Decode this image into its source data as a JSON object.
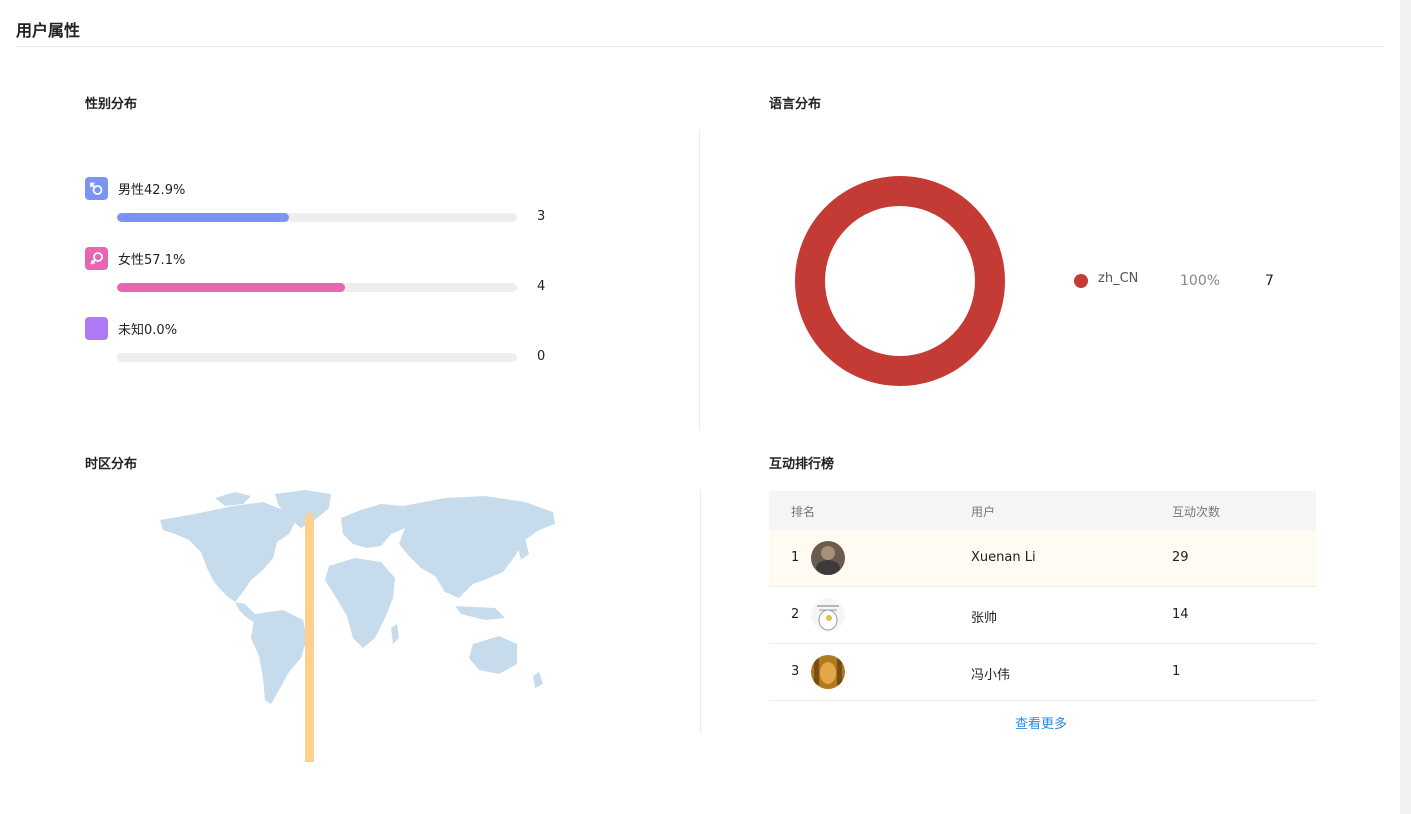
{
  "page": {
    "title": "用户属性"
  },
  "gender": {
    "title": "性别分布",
    "items": [
      {
        "key": "male",
        "label": "男性",
        "percent": "42.9%",
        "fraction": 0.429,
        "count": "3",
        "color": "#7b93f3",
        "icon": "male-icon"
      },
      {
        "key": "female",
        "label": "女性",
        "percent": "57.1%",
        "fraction": 0.571,
        "count": "4",
        "color": "#e666b3",
        "icon": "female-icon"
      },
      {
        "key": "unknown",
        "label": "未知",
        "percent": "0.0%",
        "fraction": 0.0,
        "count": "0",
        "color": "#b07af6",
        "icon": "unknown-icon"
      }
    ]
  },
  "language": {
    "title": "语言分布",
    "legend": [
      {
        "label": "zh_CN",
        "percent": "100%",
        "count": "7",
        "color": "#c43a35"
      }
    ]
  },
  "timezone": {
    "title": "时区分布",
    "map_color": "#c6dcec",
    "highlight_color": "#fdd08e"
  },
  "ranking": {
    "title": "互动排行榜",
    "columns": [
      "排名",
      "用户",
      "互动次数"
    ],
    "rows": [
      {
        "rank": "1",
        "user": "Xuenan Li",
        "count": "29"
      },
      {
        "rank": "2",
        "user": "张帅",
        "count": "14"
      },
      {
        "rank": "3",
        "user": "冯小伟",
        "count": "1"
      }
    ],
    "view_more": "查看更多"
  }
}
